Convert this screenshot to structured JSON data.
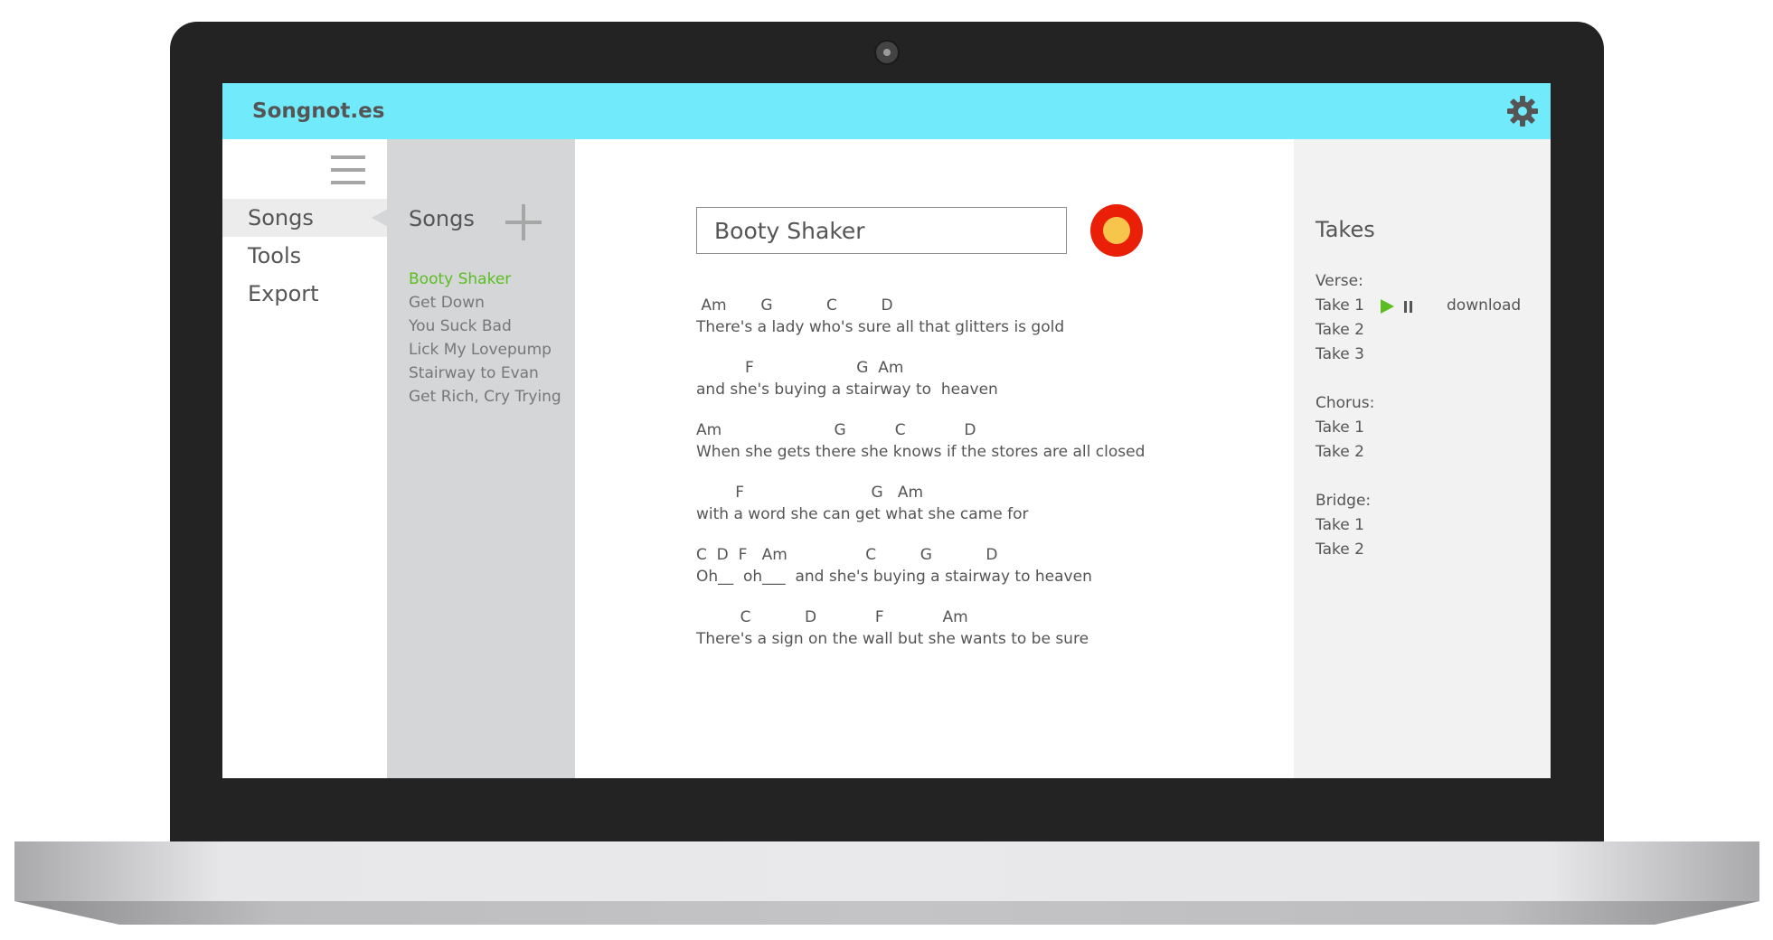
{
  "app": {
    "title": "Songnot.es"
  },
  "colors": {
    "topbar": "#71ebfb",
    "accent_green": "#5cbd21",
    "record_red": "#ea1f07",
    "record_inner": "#f8c54c"
  },
  "nav": {
    "items": [
      {
        "label": "Songs",
        "active": true
      },
      {
        "label": "Tools",
        "active": false
      },
      {
        "label": "Export",
        "active": false
      }
    ]
  },
  "songs": {
    "title": "Songs",
    "items": [
      {
        "label": "Booty Shaker",
        "active": true
      },
      {
        "label": "Get Down",
        "active": false
      },
      {
        "label": "You Suck Bad",
        "active": false
      },
      {
        "label": "Lick My Lovepump",
        "active": false
      },
      {
        "label": "Stairway to Evan",
        "active": false
      },
      {
        "label": "Get Rich, Cry Trying",
        "active": false
      }
    ]
  },
  "editor": {
    "song_title": "Booty Shaker",
    "stanzas": [
      {
        "chords": " Am       G           C         D",
        "lyric": "There's a lady who's sure all that glitters is gold"
      },
      {
        "chords": "          F                     G  Am",
        "lyric": "and she's buying a stairway to  heaven"
      },
      {
        "chords": "Am                       G          C            D",
        "lyric": "When she gets there she knows if the stores are all closed"
      },
      {
        "chords": "        F                          G   Am",
        "lyric": "with a word she can get what she came for"
      },
      {
        "chords": "C  D  F   Am                C         G           D",
        "lyric": "Oh__  oh___  and she's buying a stairway to heaven"
      },
      {
        "chords": "         C           D            F            Am",
        "lyric": "There's a sign on the wall but she wants to be sure"
      }
    ]
  },
  "takes": {
    "title": "Takes",
    "download_label": "download",
    "sections": [
      {
        "label": "Verse:",
        "takes": [
          "Take 1",
          "Take 2",
          "Take 3"
        ]
      },
      {
        "label": "Chorus:",
        "takes": [
          "Take 1",
          "Take 2"
        ]
      },
      {
        "label": "Bridge:",
        "takes": [
          "Take 1",
          "Take 2"
        ]
      }
    ]
  }
}
